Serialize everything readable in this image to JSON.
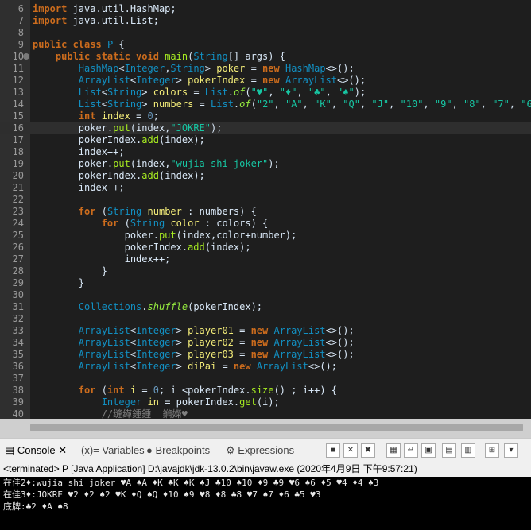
{
  "editor": {
    "lines": [
      {
        "n": "6",
        "html": "<span class=\"kw\">import</span> java.util.HashMap;"
      },
      {
        "n": "7",
        "html": "<span class=\"kw\">import</span> java.util.List;"
      },
      {
        "n": "8",
        "html": ""
      },
      {
        "n": "9",
        "html": "<span class=\"kw\">public class</span> <span class=\"ty\">P</span> {"
      },
      {
        "n": "10",
        "html": "    <span class=\"kw\">public static void</span> <span class=\"mth\">main</span>(<span class=\"ty\">String</span>[] args) {"
      },
      {
        "n": "11",
        "html": "        <span class=\"ty\">HashMap</span>&lt;<span class=\"ty\">Integer</span>,<span class=\"ty\">String</span>&gt; <span class=\"var\">poker</span> = <span class=\"kw\">new</span> <span class=\"ty\">HashMap</span>&lt;&gt;();"
      },
      {
        "n": "12",
        "html": "        <span class=\"ty\">ArrayList</span>&lt;<span class=\"ty\">Integer</span>&gt; <span class=\"var\">pokerIndex</span> = <span class=\"kw\">new</span> <span class=\"ty\">ArrayList</span>&lt;&gt;();"
      },
      {
        "n": "13",
        "html": "        <span class=\"ty\">List</span>&lt;<span class=\"ty\">String</span>&gt; <span class=\"var\">colors</span> = <span class=\"ty\">List</span>.<span class=\"it\">of</span>(<span class=\"str\">\"♥\"</span>, <span class=\"str\">\"♦\"</span>, <span class=\"str\">\"♣\"</span>, <span class=\"str\">\"♠\"</span>);"
      },
      {
        "n": "14",
        "html": "        <span class=\"ty\">List</span>&lt;<span class=\"ty\">String</span>&gt; <span class=\"var\">numbers</span> = <span class=\"ty\">List</span>.<span class=\"it\">of</span>(<span class=\"str\">\"2\"</span>, <span class=\"str\">\"A\"</span>, <span class=\"str\">\"K\"</span>, <span class=\"str\">\"Q\"</span>, <span class=\"str\">\"J\"</span>, <span class=\"str\">\"10\"</span>, <span class=\"str\">\"9\"</span>, <span class=\"str\">\"8\"</span>, <span class=\"str\">\"7\"</span>, <span class=\"str\">\"6\"</span>,"
      },
      {
        "n": "15",
        "html": "        <span class=\"kw\">int</span> <span class=\"var\">index</span> = <span class=\"num\">0</span>;"
      },
      {
        "n": "16",
        "html": "        poker.<span class=\"mth\">put</span>(index,<span class=\"str\">\"JOKRE\"</span>);",
        "hl": true
      },
      {
        "n": "17",
        "html": "        pokerIndex.<span class=\"mth\">add</span>(index);"
      },
      {
        "n": "18",
        "html": "        index++;"
      },
      {
        "n": "19",
        "html": "        poker.<span class=\"mth\">put</span>(index,<span class=\"str\">\"wujia shi joker\"</span>);"
      },
      {
        "n": "20",
        "html": "        pokerIndex.<span class=\"mth\">add</span>(index);"
      },
      {
        "n": "21",
        "html": "        index++;"
      },
      {
        "n": "22",
        "html": ""
      },
      {
        "n": "23",
        "html": "        <span class=\"kw\">for</span> (<span class=\"ty\">String</span> <span class=\"var\">number</span> : numbers) {"
      },
      {
        "n": "24",
        "html": "            <span class=\"kw\">for</span> (<span class=\"ty\">String</span> <span class=\"var\">color</span> : colors) {"
      },
      {
        "n": "25",
        "html": "                poker.<span class=\"mth\">put</span>(index,color+number);"
      },
      {
        "n": "26",
        "html": "                pokerIndex.<span class=\"mth\">add</span>(index);"
      },
      {
        "n": "27",
        "html": "                index++;"
      },
      {
        "n": "28",
        "html": "            }"
      },
      {
        "n": "29",
        "html": "        }"
      },
      {
        "n": "30",
        "html": ""
      },
      {
        "n": "31",
        "html": "        <span class=\"ty\">Collections</span>.<span class=\"it\">shuffle</span>(pokerIndex);"
      },
      {
        "n": "32",
        "html": ""
      },
      {
        "n": "33",
        "html": "        <span class=\"ty\">ArrayList</span>&lt;<span class=\"ty\">Integer</span>&gt; <span class=\"var\">player01</span> = <span class=\"kw\">new</span> <span class=\"ty\">ArrayList</span>&lt;&gt;();"
      },
      {
        "n": "34",
        "html": "        <span class=\"ty\">ArrayList</span>&lt;<span class=\"ty\">Integer</span>&gt; <span class=\"var\">player02</span> = <span class=\"kw\">new</span> <span class=\"ty\">ArrayList</span>&lt;&gt;();"
      },
      {
        "n": "35",
        "html": "        <span class=\"ty\">ArrayList</span>&lt;<span class=\"ty\">Integer</span>&gt; <span class=\"var\">player03</span> = <span class=\"kw\">new</span> <span class=\"ty\">ArrayList</span>&lt;&gt;();"
      },
      {
        "n": "36",
        "html": "        <span class=\"ty\">ArrayList</span>&lt;<span class=\"ty\">Integer</span>&gt; <span class=\"var\">diPai</span> = <span class=\"kw\">new</span> <span class=\"ty\">ArrayList</span>&lt;&gt;();"
      },
      {
        "n": "37",
        "html": ""
      },
      {
        "n": "38",
        "html": "        <span class=\"kw\">for</span> (<span class=\"kw\">int</span> <span class=\"var\">i</span> = <span class=\"num\">0</span>; i &lt;pokerIndex.<span class=\"mth\">size</span>() ; i++) {"
      },
      {
        "n": "39",
        "html": "            <span class=\"ty\">Integer</span> <span class=\"var\">in</span> = pokerIndex.<span class=\"mth\">get</span>(i);"
      },
      {
        "n": "40",
        "html": "            <span class=\"cm\">//缝缂鍾鍾  鏅嬫♥</span>"
      }
    ]
  },
  "tabs": {
    "console": "Console",
    "variables": "Variables",
    "breakpoints": "Breakpoints",
    "expressions": "Expressions"
  },
  "status": "<terminated> P [Java Application] D:\\javajdk\\jdk-13.0.2\\bin\\javaw.exe (2020年4月9日 下午9:57:21)",
  "console_lines": [
    "在佳2♦:wujia shi joker ♥A ♠A ♦K ♣K ♠K ♠J ♣10 ♠10 ♦9 ♣9 ♥6 ♠6 ♦5 ♥4 ♦4 ♠3",
    "在佳3♦:JOKRE ♥2 ♦2 ♠2 ♥K ♦Q ♠Q ♦10 ♠9 ♥8 ♦8 ♣8 ♥7 ♠7 ♦6 ♣5 ♥3",
    "底牌:♣2 ♦A ♠8"
  ]
}
